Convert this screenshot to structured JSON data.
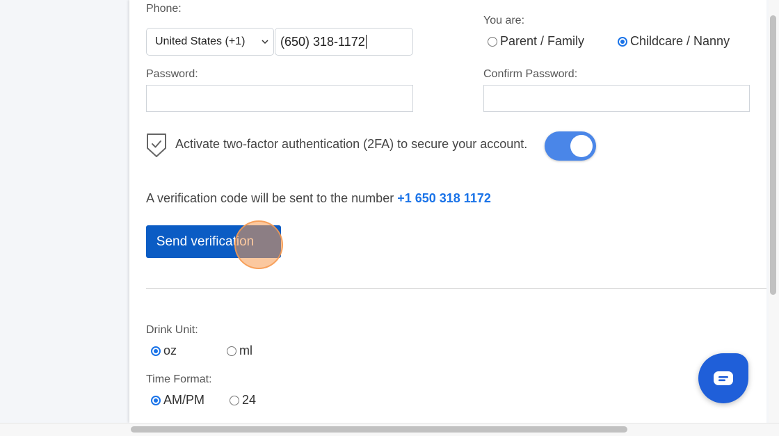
{
  "phone": {
    "label": "Phone:",
    "country_value": "United States (+1)",
    "number_value": "(650) 318-1172"
  },
  "role": {
    "label": "You are:",
    "options": [
      "Parent / Family",
      "Childcare / Nanny"
    ],
    "selected": "Childcare / Nanny"
  },
  "password": {
    "label": "Password:",
    "value": ""
  },
  "confirm_password": {
    "label": "Confirm Password:",
    "value": ""
  },
  "two_factor": {
    "text": "Activate two-factor authentication (2FA) to secure your account.",
    "enabled": true
  },
  "verification": {
    "text": "A verification code will be sent to the number",
    "number": "+1 650 318 1172",
    "button_label": "Send verification"
  },
  "drink_unit": {
    "label": "Drink Unit:",
    "options": [
      "oz",
      "ml"
    ],
    "selected": "oz"
  },
  "time_format": {
    "label": "Time Format:",
    "options": [
      "AM/PM",
      "24"
    ],
    "selected": "AM/PM"
  },
  "icons": {
    "shield": "shield-check-icon",
    "chat": "chat-bubble-icon",
    "chevron": "chevron-down-icon"
  },
  "colors": {
    "accent": "#1a73e8",
    "button": "#0b5cc4",
    "toggle": "#4a86e8",
    "chat": "#1f5fd9",
    "click_marker": "#f79a50"
  }
}
